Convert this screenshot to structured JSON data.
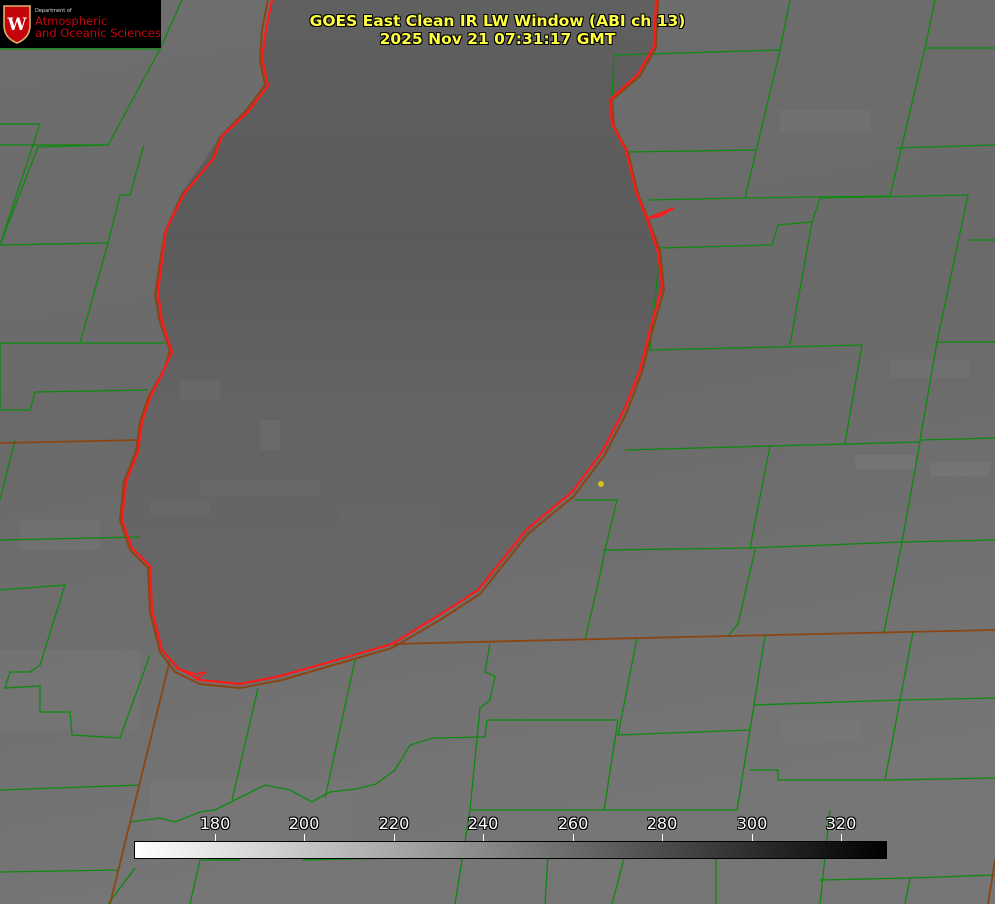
{
  "title": {
    "line1": "GOES East Clean IR LW Window (ABI ch 13)",
    "line2": "2025 Nov 21 07:31:17 GMT"
  },
  "logo": {
    "department": "Department of",
    "line1": "Atmospheric",
    "line2": "and Oceanic Sciences",
    "crest_letter": "W",
    "icon": "uw-crest-icon"
  },
  "colorbar": {
    "ticks": [
      "180",
      "200",
      "220",
      "240",
      "260",
      "280",
      "300",
      "320"
    ],
    "gradient_start": "#ffffff",
    "gradient_end": "#000000",
    "tick_values": [
      180,
      200,
      220,
      240,
      260,
      280,
      300,
      320
    ]
  },
  "map": {
    "background_color": "#6a6a6a",
    "lake_color": "#5d5d5d",
    "county_line_color": "#0d8a0d",
    "state_line_color": "#8b4513",
    "shoreline_color": "#ff1a1a",
    "marker_color": "#d4c21a"
  }
}
